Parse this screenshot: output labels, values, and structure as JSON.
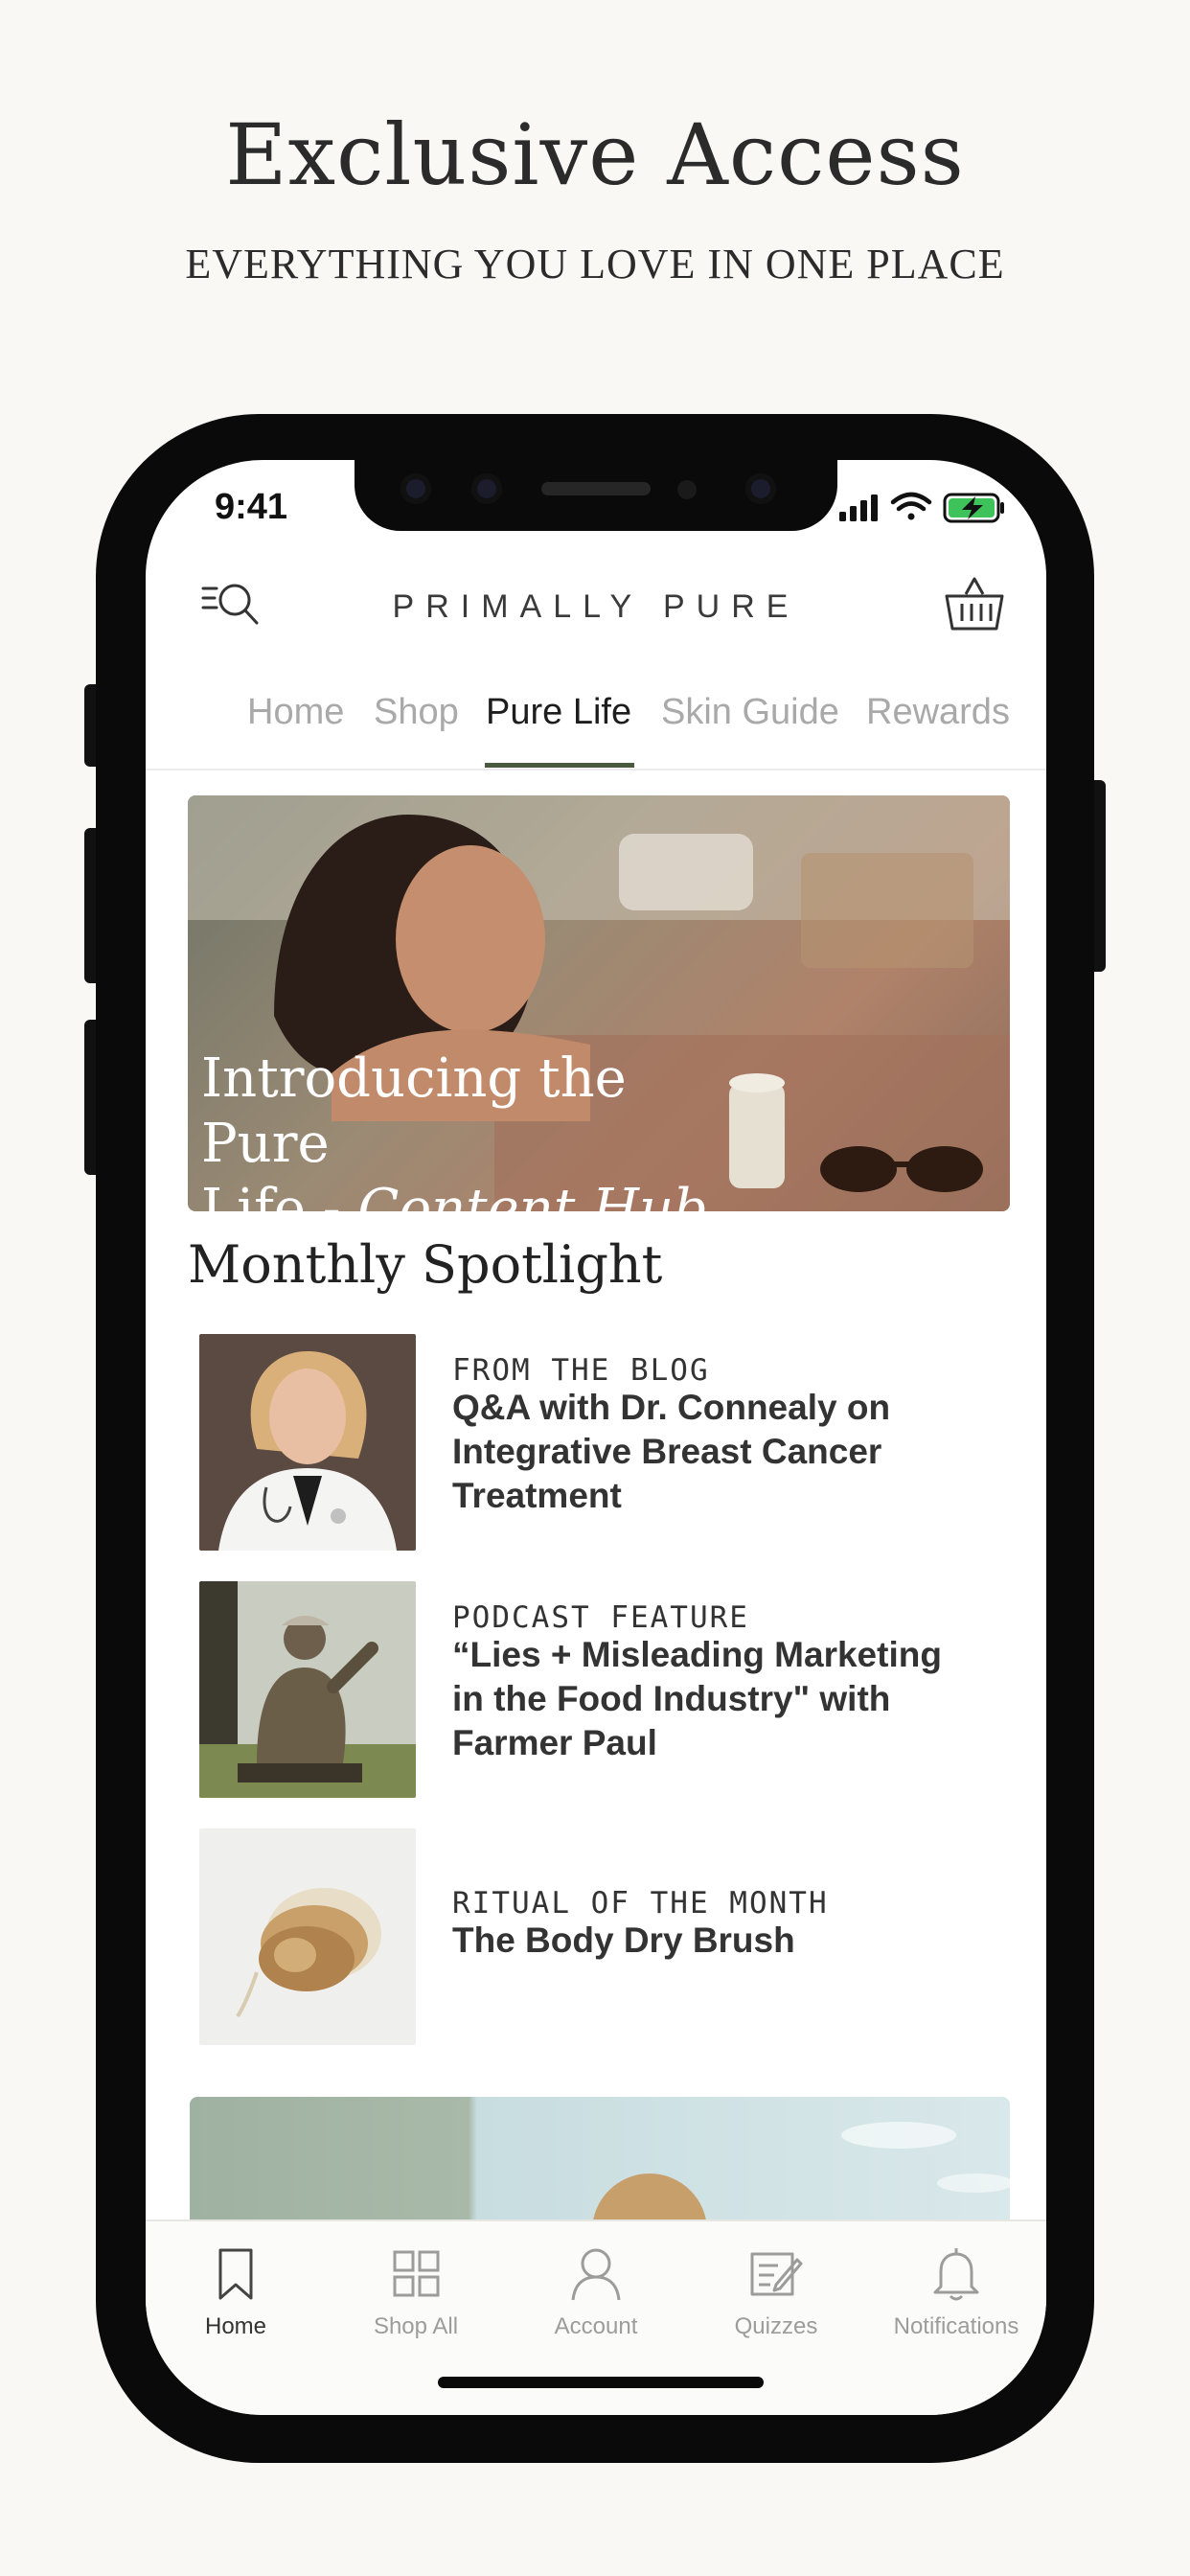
{
  "promo": {
    "title": "Exclusive Access",
    "subtitle": "EVERYTHING YOU LOVE IN ONE PLACE"
  },
  "status_bar": {
    "time": "9:41"
  },
  "header": {
    "brand": "PRIMALLY PURE",
    "icons": {
      "menu": "menu-search-icon",
      "cart": "basket-icon"
    }
  },
  "tabs": [
    {
      "label": "Home"
    },
    {
      "label": "Shop"
    },
    {
      "label": "Pure Life",
      "active": true
    },
    {
      "label": "Skin Guide"
    },
    {
      "label": "Rewards"
    }
  ],
  "banner": {
    "line1": "Introducing the Pure",
    "line2_prefix": "Life - ",
    "line2_italic": "Content Hub"
  },
  "spotlight": {
    "title": "Monthly Spotlight",
    "items": [
      {
        "kicker": "FROM THE BLOG",
        "title": "Q&A with Dr. Connealy on Integrative Breast Cancer Treatment"
      },
      {
        "kicker": "PODCAST FEATURE",
        "title": "“Lies + Misleading Marketing in the Food Industry\" with Farmer Paul"
      },
      {
        "kicker": "RITUAL OF THE MONTH",
        "title": "The Body Dry Brush"
      }
    ]
  },
  "tabbar": [
    {
      "label": "Home",
      "icon": "bookmark-icon",
      "active": true
    },
    {
      "label": "Shop All",
      "icon": "grid-icon"
    },
    {
      "label": "Account",
      "icon": "person-icon"
    },
    {
      "label": "Quizzes",
      "icon": "quiz-icon"
    },
    {
      "label": "Notifications",
      "icon": "bell-icon"
    }
  ],
  "colors": {
    "background": "#f9f8f5",
    "accent": "#4a5a3f",
    "text": "#333333",
    "inactive": "#a9a9a9"
  }
}
